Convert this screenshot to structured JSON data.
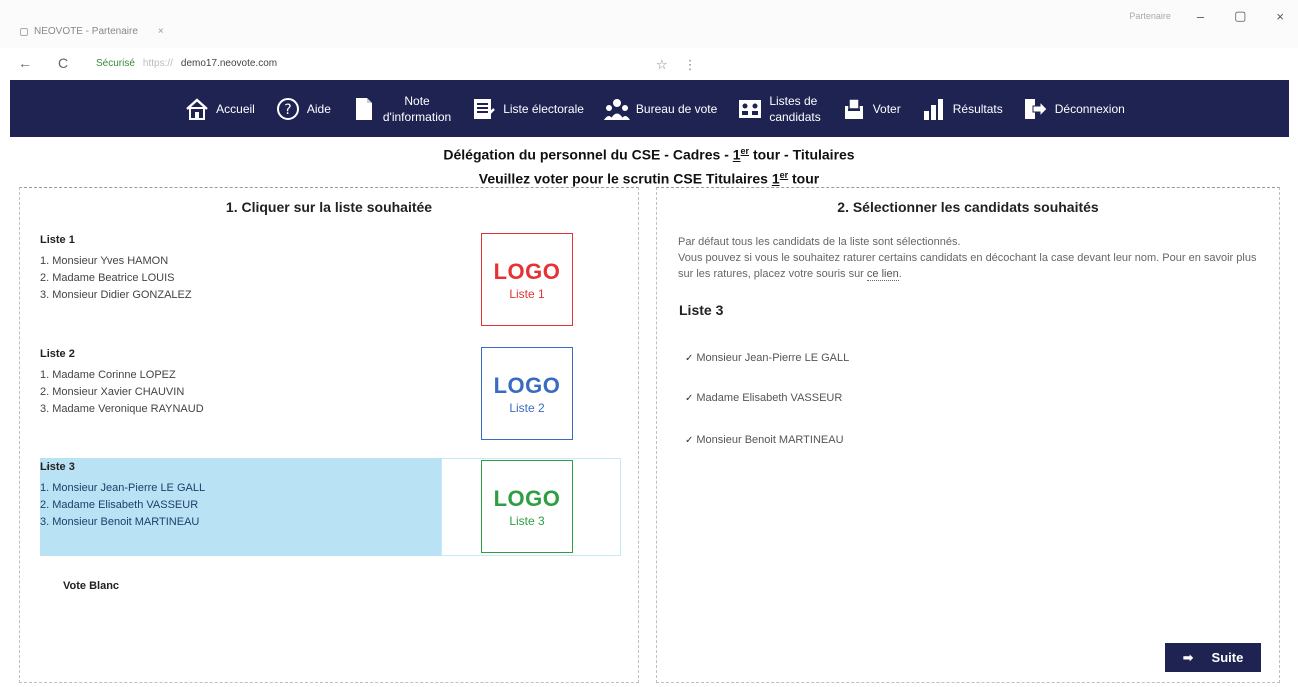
{
  "browser": {
    "tab_title": "NEOVOTE - Partenaire",
    "tab_close": "×",
    "user_label": "Partenaire",
    "minimize": "–",
    "maximize": "▢",
    "close": "×",
    "back": "←",
    "reload": "C",
    "secure_label": "Sécurisé",
    "protocol": "https://",
    "domain": "demo17.neovote.com",
    "star": "☆",
    "menu": "⋮"
  },
  "nav": {
    "accueil": "Accueil",
    "aide": "Aide",
    "note_line1": "Note",
    "note_line2": "d'information",
    "liste_electorale": "Liste électorale",
    "bureau": "Bureau de vote",
    "listes_line1": "Listes de",
    "listes_line2": "candidats",
    "voter": "Voter",
    "resultats": "Résultats",
    "deconnexion": "Déconnexion"
  },
  "heading": {
    "title_prefix": "Délégation du personnel du CSE - Cadres - ",
    "title_num": "1",
    "title_sup": "er",
    "title_suffix": " tour - Titulaires",
    "subtitle_prefix": "Veuillez voter pour le scrutin CSE Titulaires ",
    "subtitle_num": "1",
    "subtitle_sup": "er",
    "subtitle_suffix": " tour"
  },
  "left": {
    "title": "1. Cliquer sur la liste souhaitée",
    "selected_marker": "*",
    "listes": [
      {
        "name": "Liste 1",
        "candidates": [
          "1. Monsieur Yves HAMON",
          "2. Madame Beatrice LOUIS",
          "3. Monsieur Didier GONZALEZ"
        ],
        "logo": "LOGO",
        "logo_sub": "Liste 1",
        "color": "#e53333"
      },
      {
        "name": "Liste 2",
        "candidates": [
          "1. Madame Corinne LOPEZ",
          "2. Monsieur Xavier CHAUVIN",
          "3. Madame Veronique RAYNAUD"
        ],
        "logo": "LOGO",
        "logo_sub": "Liste 2",
        "color": "#3a6bc2"
      },
      {
        "name": "Liste 3",
        "candidates": [
          "1. Monsieur Jean-Pierre LE GALL",
          "2. Madame Elisabeth VASSEUR",
          "3. Monsieur Benoit MARTINEAU"
        ],
        "logo": "LOGO",
        "logo_sub": "Liste 3",
        "color": "#2e9e43"
      }
    ],
    "vote_blanc": "Vote Blanc"
  },
  "right": {
    "title": "2. Sélectionner les candidats souhaités",
    "intro_line1": "Par défaut tous les candidats de la liste sont sélectionnés.",
    "intro_line2": "Vous pouvez si vous le souhaitez raturer certains candidats en décochant la case devant leur nom. Pour en savoir plus sur les ratures, placez votre souris sur ",
    "intro_link": "ce lien",
    "intro_end": ".",
    "selected_list": "Liste 3",
    "check": "✓",
    "candidates": [
      "Monsieur Jean-Pierre LE GALL",
      "Madame Elisabeth VASSEUR",
      "Monsieur Benoit MARTINEAU"
    ],
    "suite_label": "Suite",
    "suite_arrow": "➡"
  },
  "colors": {
    "nav_bg": "#1e2352",
    "selected_bg": "#b9e3f4"
  }
}
